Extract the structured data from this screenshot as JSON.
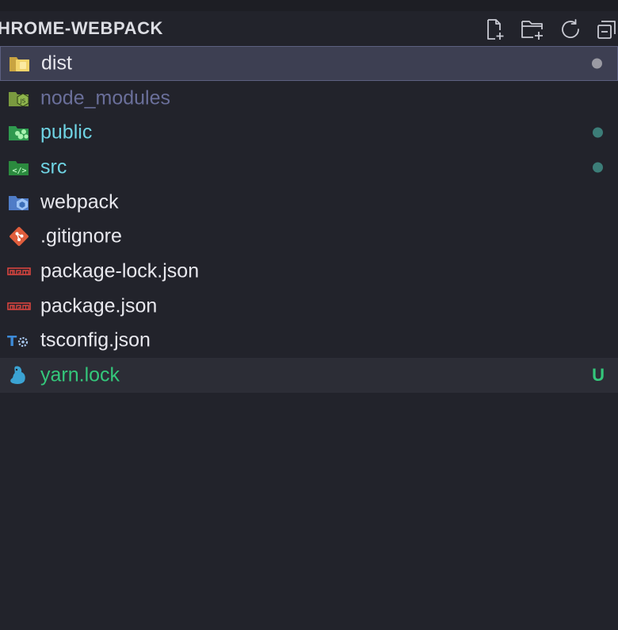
{
  "explorer": {
    "title": "HROME-WEBPACK",
    "actions": [
      {
        "name": "new-file",
        "icon": "new-file-icon"
      },
      {
        "name": "new-folder",
        "icon": "new-folder-icon"
      },
      {
        "name": "refresh",
        "icon": "refresh-icon"
      },
      {
        "name": "collapse-all",
        "icon": "collapse-all-icon"
      }
    ]
  },
  "colors": {
    "background": "#22232b",
    "selection": "#3d3f52",
    "folder_text": "#e8e8ee",
    "modified_text": "#6fd3e3",
    "ignored_text": "#6a6f9a",
    "untracked_text": "#34c77b",
    "dot_gray": "#9a9aa3",
    "dot_teal": "#3c7d78"
  },
  "files": [
    {
      "name": "dist",
      "type": "folder",
      "icon": "dist-folder-icon",
      "status": "selected",
      "decoration": "dot",
      "decoration_color": "#9a9aa3",
      "text_color": "#e8e8ee"
    },
    {
      "name": "node_modules",
      "type": "folder",
      "icon": "node-folder-icon",
      "status": "ignored",
      "decoration": "",
      "text_color": "#6a6f9a"
    },
    {
      "name": "public",
      "type": "folder",
      "icon": "public-folder-icon",
      "status": "modified",
      "decoration": "dot",
      "decoration_color": "#3c7d78",
      "text_color": "#6fd3e3"
    },
    {
      "name": "src",
      "type": "folder",
      "icon": "src-folder-icon",
      "status": "modified",
      "decoration": "dot",
      "decoration_color": "#3c7d78",
      "text_color": "#6fd3e3"
    },
    {
      "name": "webpack",
      "type": "folder",
      "icon": "webpack-folder-icon",
      "status": "",
      "decoration": "",
      "text_color": "#e8e8ee"
    },
    {
      "name": ".gitignore",
      "type": "file",
      "icon": "git-icon",
      "status": "",
      "decoration": "",
      "text_color": "#e8e8ee"
    },
    {
      "name": "package-lock.json",
      "type": "file",
      "icon": "npm-icon",
      "status": "",
      "decoration": "",
      "text_color": "#e8e8ee"
    },
    {
      "name": "package.json",
      "type": "file",
      "icon": "npm-icon",
      "status": "",
      "decoration": "",
      "text_color": "#e8e8ee"
    },
    {
      "name": "tsconfig.json",
      "type": "file",
      "icon": "tsconfig-icon",
      "status": "",
      "decoration": "",
      "text_color": "#e8e8ee"
    },
    {
      "name": "yarn.lock",
      "type": "file",
      "icon": "yarn-icon",
      "status": "untracked",
      "decoration": "U",
      "text_color": "#34c77b"
    }
  ]
}
